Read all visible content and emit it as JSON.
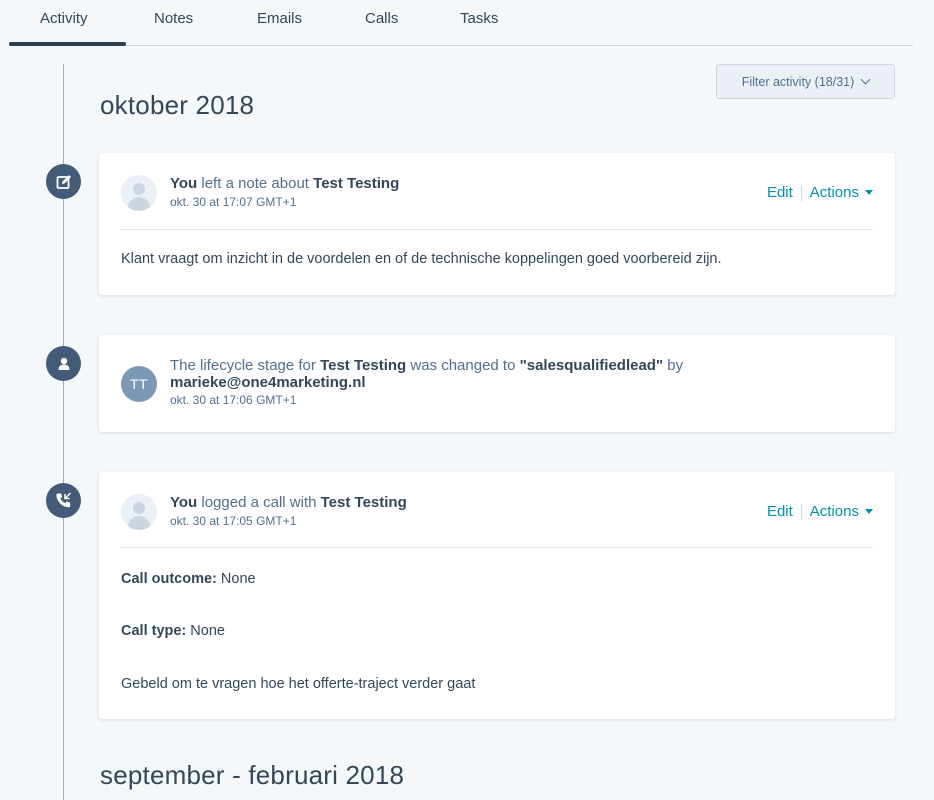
{
  "tabs": [
    {
      "label": "Activity",
      "active": true
    },
    {
      "label": "Notes"
    },
    {
      "label": "Emails"
    },
    {
      "label": "Calls"
    },
    {
      "label": "Tasks"
    }
  ],
  "filter": {
    "label": "Filter activity (18/31)"
  },
  "months": [
    "oktober 2018",
    "september - februari 2018"
  ],
  "cards": [
    {
      "icon": "note-edit-icon",
      "actor": "You",
      "verb": " left a note about ",
      "subject": "Test Testing",
      "timestamp": "okt. 30 at 17:07 GMT+1",
      "edit_label": "Edit",
      "actions_label": "Actions",
      "body": "Klant vraagt om inzicht in de voordelen en of de technische koppelingen goed voorbereid zijn."
    },
    {
      "icon": "contact-icon",
      "avatar_initials": "TT",
      "text_a": "The lifecycle stage for ",
      "subject": "Test Testing",
      "text_b": " was changed to ",
      "stage": "\"salesqualifiedlead\"",
      "text_c": " by",
      "by": "marieke@one4marketing.nl",
      "timestamp": "okt. 30 at 17:06 GMT+1"
    },
    {
      "icon": "call-icon",
      "actor": "You",
      "verb": " logged a call with ",
      "subject": "Test Testing",
      "timestamp": "okt. 30 at 17:05 GMT+1",
      "edit_label": "Edit",
      "actions_label": "Actions",
      "outcome_label": "Call outcome:",
      "outcome_value": " None",
      "type_label": "Call type:",
      "type_value": " None",
      "body": "Gebeld om te vragen hoe het offerte-traject verder gaat"
    }
  ],
  "colors": {
    "accent": "#0091ae",
    "timeline_icon": "#425b76",
    "text": "#33475b",
    "background": "#f5f8fa"
  }
}
